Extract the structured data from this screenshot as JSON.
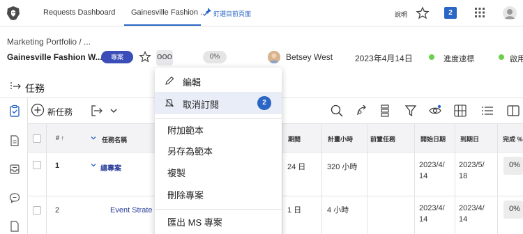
{
  "topbar": {
    "tabs": [
      "Requests Dashboard",
      "Gainesville Fashion ..."
    ],
    "pin_label": "釘選目前頁面",
    "help_label": "說明",
    "notif_count": "2"
  },
  "header": {
    "breadcrumb": "Marketing Portfolio  /  ...",
    "project_name": "Gainesville Fashion W...",
    "project_badge": "專案",
    "more": "ooo",
    "percent": "0%",
    "owner": "Betsey West",
    "date": "2023年4月14日",
    "status_1": "進度速標",
    "status_2": "啟用"
  },
  "section": {
    "title": "任務"
  },
  "toolbar": {
    "new_task": "新任務"
  },
  "table": {
    "headers": {
      "num": "# ↑",
      "name": "任務名稱",
      "duration": "期間",
      "planned_hours": "計畫小時",
      "predecessors": "前置任務",
      "start": "開始日期",
      "due": "到期日",
      "complete": "完成 %"
    },
    "rows": [
      {
        "num": "1",
        "name": "總專案",
        "duration": "24 日",
        "hours": "320 小時",
        "start": [
          "2023/4/",
          "14"
        ],
        "due": [
          "2023/5/",
          "18"
        ],
        "complete": "0%"
      },
      {
        "num": "2",
        "name": "Event Strate",
        "duration": "1 日",
        "hours": "4 小時",
        "start": [
          "2023/4/",
          "14"
        ],
        "due": [
          "2023/4/",
          "14"
        ],
        "complete": "0%"
      }
    ]
  },
  "menu": {
    "items": [
      "編輯",
      "取消訂閱",
      "附加範本",
      "另存為範本",
      "複製",
      "刪除專案",
      "匯出 MS 專案"
    ],
    "unsubscribe_badge": "2"
  },
  "colors": {
    "accent": "#2b66c6",
    "badge": "#3a4db8",
    "status_dot": "#6bd04c"
  }
}
